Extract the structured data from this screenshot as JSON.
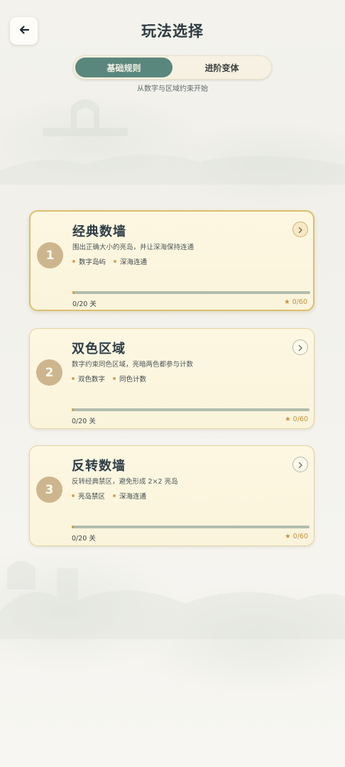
{
  "header": {
    "title": "玩法选择"
  },
  "tabs": [
    {
      "label": "基础规则",
      "active": true
    },
    {
      "label": "进阶变体",
      "active": false
    }
  ],
  "subtitle": "从数字与区域约束开始",
  "cards": [
    {
      "number": "1",
      "title": "经典数墙",
      "description": "围出正确大小的亮岛，并让深海保持连通",
      "tags": [
        "数字岛屿",
        "深海连通"
      ],
      "progress_text": "0/20 关",
      "progress_fraction": 0,
      "stars_text": "★ 0/60",
      "selected": true
    },
    {
      "number": "2",
      "title": "双色区域",
      "description": "数字约束同色区域，亮暗两色都参与计数",
      "tags": [
        "双色数字",
        "同色计数"
      ],
      "progress_text": "0/20 关",
      "progress_fraction": 0,
      "stars_text": "★ 0/60",
      "selected": false
    },
    {
      "number": "3",
      "title": "反转数墙",
      "description": "反转经典禁区，避免形成 2×2 亮岛",
      "tags": [
        "亮岛禁区",
        "深海连通"
      ],
      "progress_text": "0/20 关",
      "progress_fraction": 0,
      "stars_text": "★ 0/60",
      "selected": false
    }
  ],
  "colors": {
    "accent": "#5a877d",
    "card_bg": "#fbf4dc",
    "gold": "#c9a14a",
    "number_circle": "#cdb68e"
  },
  "icons": {
    "back": "arrow-left-icon",
    "open": "chevron-right-icon"
  }
}
